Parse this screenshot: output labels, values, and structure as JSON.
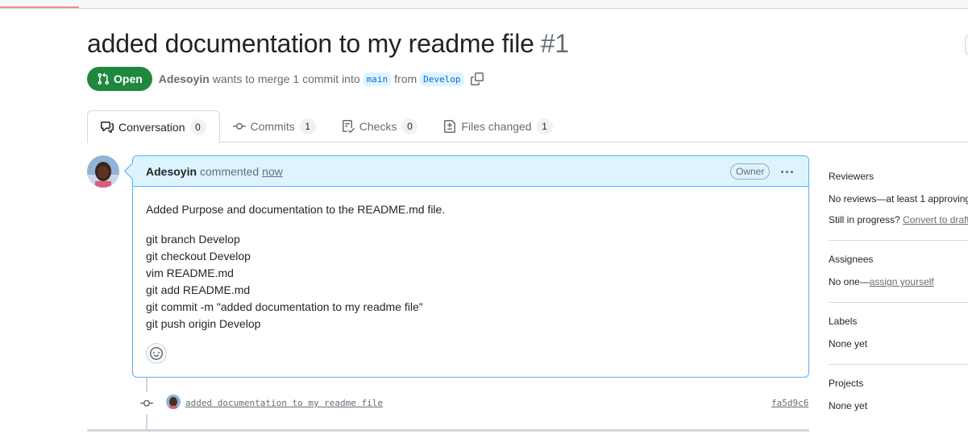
{
  "pr": {
    "title": "added documentation to my readme file",
    "number": "#1",
    "state": "Open",
    "author": "Adesoyin",
    "merge_text": "wants to merge 1 commit into",
    "base_branch": "main",
    "from_text": "from",
    "head_branch": "Develop"
  },
  "tabs": [
    {
      "label": "Conversation",
      "count": "0"
    },
    {
      "label": "Commits",
      "count": "1"
    },
    {
      "label": "Checks",
      "count": "0"
    },
    {
      "label": "Files changed",
      "count": "1"
    }
  ],
  "comment": {
    "author": "Adesoyin",
    "action": "commented",
    "time": "now",
    "role_badge": "Owner",
    "body_intro": "Added Purpose and documentation to the README.md file.",
    "commands": [
      "git branch Develop",
      "git checkout Develop",
      "vim README.md",
      "git add README.md",
      "git commit -m \"added documentation to my readme file\"",
      "git push origin Develop"
    ]
  },
  "commit": {
    "message": "added documentation to my readme file",
    "sha": "fa5d9c6"
  },
  "sidebar": {
    "reviewers": {
      "title": "Reviewers",
      "line1": "No reviews—at least 1 approving",
      "line2_prefix": "Still in progress?",
      "line2_link": "Convert to draft"
    },
    "assignees": {
      "title": "Assignees",
      "prefix": "No one—",
      "link": "assign yourself"
    },
    "labels": {
      "title": "Labels",
      "value": "None yet"
    },
    "projects": {
      "title": "Projects",
      "value": "None yet"
    }
  },
  "icons": {
    "state": "git-pull-request-icon",
    "copy": "copy-icon",
    "conversation": "comment-discussion-icon",
    "commits": "git-commit-icon",
    "checks": "checklist-icon",
    "files": "file-diff-icon",
    "emoji": "smiley-icon",
    "kebab": "kebab-horizontal-icon"
  },
  "colors": {
    "open_green": "#1f883d",
    "link_blue": "#0969da",
    "comment_header_bg": "#ddf4ff",
    "comment_border": "#54aeff",
    "tab_accent": "#fd8c73"
  }
}
